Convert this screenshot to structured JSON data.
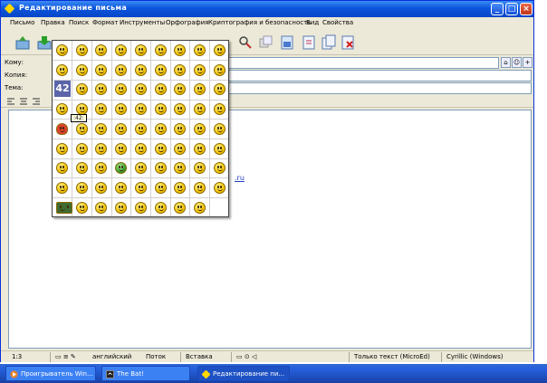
{
  "window": {
    "title": "Редактирование письма"
  },
  "menu": {
    "items": [
      "Письмо",
      "Правка",
      "Поиск",
      "Формат",
      "Инструменты",
      "Орфография",
      "Криптография и безопасность",
      "Вид",
      "Свойства"
    ]
  },
  "toolbar": {
    "icons": [
      "send-icon",
      "queue-icon",
      "save-draft-icon",
      "attach-icon",
      "paste-icon",
      "copy-icon",
      "cut-icon",
      "find-icon",
      "replace-icon",
      "spellcheck-icon",
      "insert-file-icon",
      "template-icon",
      "macros-icon",
      "copy-doc-icon",
      "delete-icon"
    ]
  },
  "header": {
    "to_label": "Кому:",
    "cc_label": "Копия:",
    "subject_label": "Тема:",
    "to_value": "",
    "cc_value": "",
    "subject_value": ""
  },
  "editor": {
    "link_text": ".ru"
  },
  "smiley_popup": {
    "badge_number": "42",
    "tooltip": ":42:"
  },
  "status": {
    "position": "1:3",
    "language": "английский",
    "mode": "Поток",
    "insert_mode": "Вставка",
    "format": "Только текст (MicroEd)",
    "charset": "Cyrillic (Windows)"
  },
  "taskbar": {
    "tasks": [
      "Проигрыватель Win...",
      "The Bat!",
      "Редактирование пи..."
    ]
  },
  "colors": {
    "title_blue": "#0a55dc",
    "window_bg": "#ece9d8",
    "taskbar_blue": "#245edb",
    "smiley_yellow": "#f5c400",
    "link_blue": "#2040c0"
  }
}
